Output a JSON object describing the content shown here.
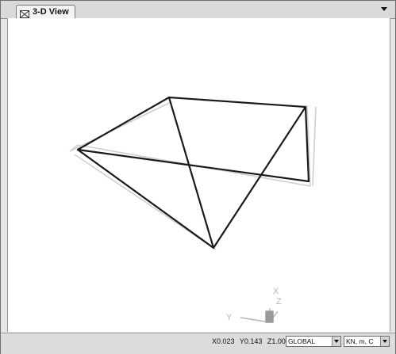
{
  "tab": {
    "label": "3-D View",
    "icon": "3d-view-icon"
  },
  "viewport": {
    "axes": {
      "x_label": "X",
      "y_label": "Y",
      "z_label": "Z"
    }
  },
  "status": {
    "x": "X0.023",
    "y": "Y0.143",
    "z": "Z1.000",
    "coord_system": "GLOBAL",
    "units": "KN, m, C"
  },
  "colors": {
    "model_lines": "#1a1a1a",
    "ghost_lines": "#c8c8c8",
    "axis_triad": "#b5b5b5",
    "background": "#ffffff",
    "chrome": "#dcdcdc"
  }
}
